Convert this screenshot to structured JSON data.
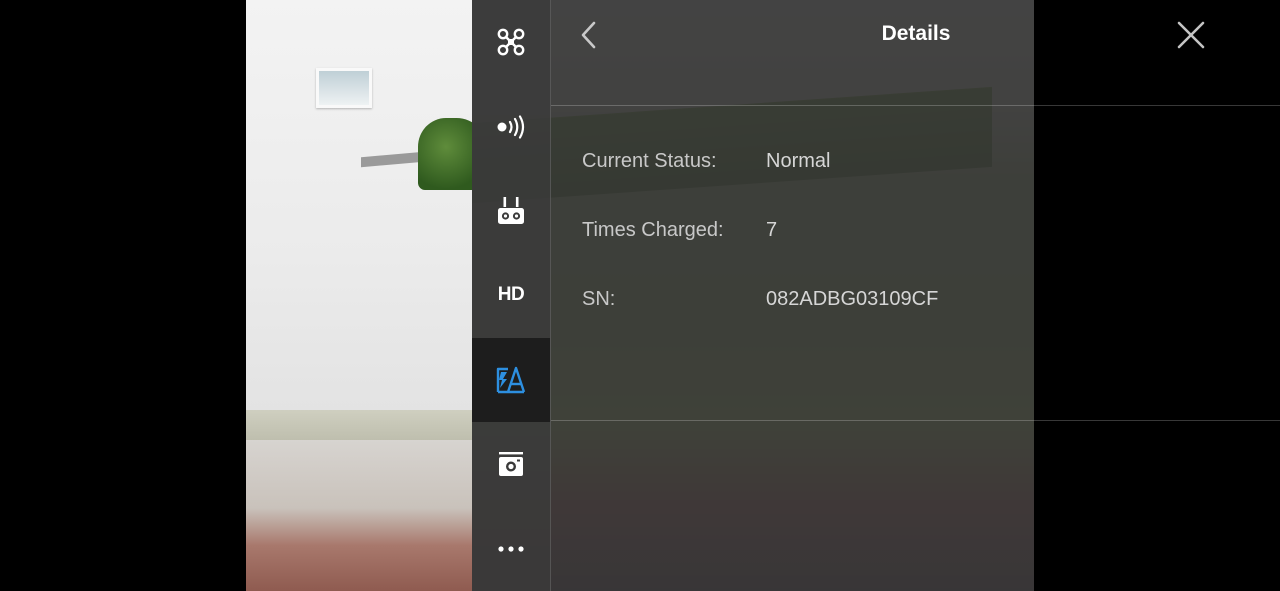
{
  "sidebar": {
    "items": [
      {
        "name": "aircraft",
        "icon": "aircraft-icon"
      },
      {
        "name": "sensors",
        "icon": "signal-icon"
      },
      {
        "name": "remote-controller",
        "icon": "remote-controller-icon"
      },
      {
        "name": "hd",
        "icon": "hd-icon",
        "label": "HD"
      },
      {
        "name": "battery",
        "icon": "battery-icon",
        "active": true
      },
      {
        "name": "camera",
        "icon": "camera-icon"
      },
      {
        "name": "more",
        "icon": "more-icon"
      }
    ],
    "accent_color": "#2d8fe0"
  },
  "header": {
    "title": "Details"
  },
  "details": [
    {
      "label": "Current Status:",
      "value": "Normal"
    },
    {
      "label": "Times Charged:",
      "value": "7"
    },
    {
      "label": "SN:",
      "value": "082ADBG03109CF"
    }
  ]
}
